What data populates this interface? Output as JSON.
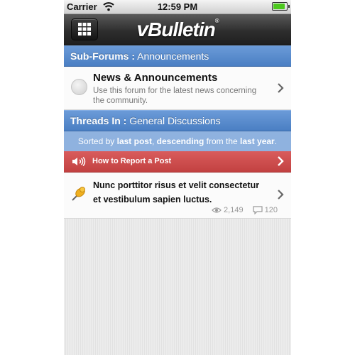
{
  "status_bar": {
    "carrier": "Carrier",
    "time": "12:59 PM",
    "battery_level": 1.0
  },
  "navbar": {
    "logo_text": "Bulletin",
    "logo_prefix": "v",
    "logo_mark": "®",
    "menu_icon": "grid-icon"
  },
  "subforums": {
    "header_label": "Sub-Forums :",
    "header_value": "Announcements",
    "items": [
      {
        "title": "News & Announcements",
        "description": "Use this forum for the latest news concerning the community."
      }
    ]
  },
  "threads": {
    "header_label": "Threads In :",
    "header_value": "General Discussions",
    "sort": {
      "p1": "Sorted by ",
      "field": "last post",
      "p2": ", ",
      "order": "descending",
      "p3": " from the ",
      "range": "last year",
      "p4": "."
    },
    "notice": {
      "label": "How to Report a Post",
      "icon": "speaker-icon"
    },
    "items": [
      {
        "title": "Nunc porttitor risus et velit consectetur et vestibulum sapien luctus.",
        "views": "2,149",
        "replies": "120",
        "icon": "pin-icon"
      }
    ]
  },
  "colors": {
    "section_blue": "#4a7fc3",
    "sort_blue": "#8fb2df",
    "notice_red": "#c24141",
    "navbar": "#2e2e2e"
  }
}
